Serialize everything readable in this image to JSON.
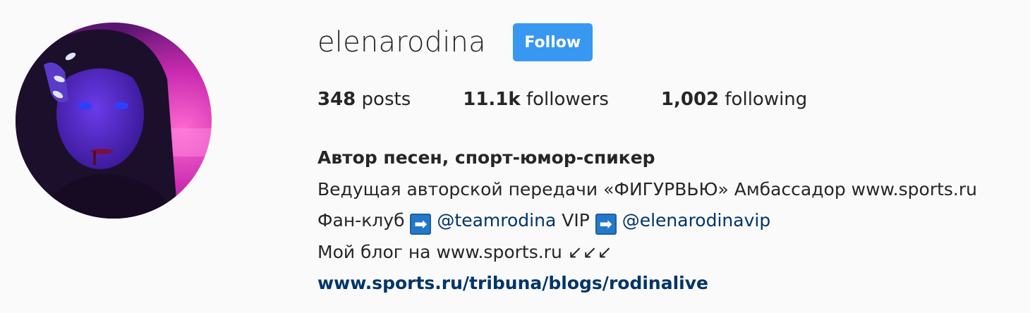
{
  "profile": {
    "username": "elenarodina",
    "follow_label": "Follow",
    "stats": {
      "posts_count": "348",
      "posts_label": "posts",
      "followers_count": "11.1k",
      "followers_label": "followers",
      "following_count": "1,002",
      "following_label": "following"
    },
    "bio": {
      "title": "Автор песен, спорт-юмор-спикер",
      "line2": "Ведущая авторской передачи «ФИГУРВЬЮ» Амбассадор www.sports.ru",
      "line3_prefix": "Фан-клуб",
      "arrow_glyph": "➡",
      "mention1": "@teamrodina",
      "line3_mid": "VIP",
      "mention2": "@elenarodinavip",
      "line4": "Мой блог на www.sports.ru ↙↙↙",
      "link": "www.sports.ru/tribuna/blogs/rodinalive"
    },
    "colors": {
      "follow_button": "#3897f0",
      "link": "#003569",
      "text": "#262626",
      "background": "#fafafa"
    },
    "avatar_icon": "profile-photo"
  }
}
